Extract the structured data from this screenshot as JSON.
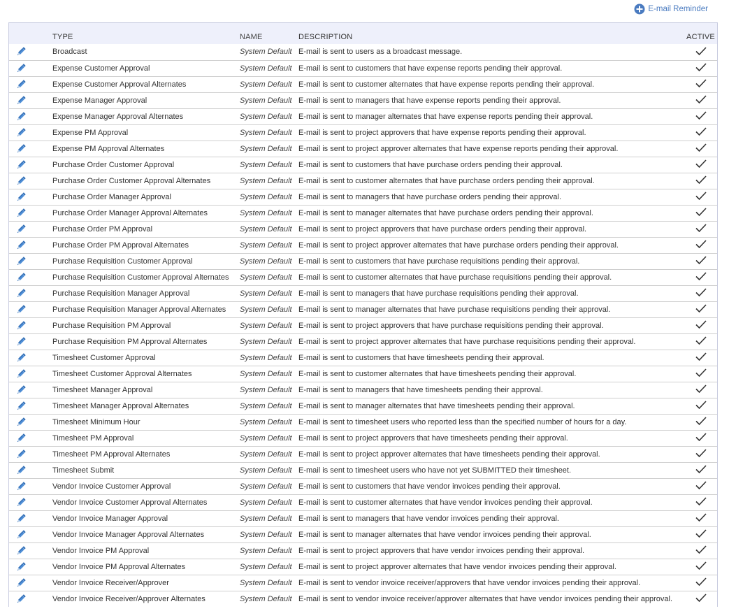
{
  "toolbar": {
    "reminder_label": "E-mail Reminder"
  },
  "columns": {
    "type": "TYPE",
    "name": "NAME",
    "description": "DESCRIPTION",
    "active": "ACTIVE"
  },
  "rows": [
    {
      "type": "Broadcast",
      "name": "System Default",
      "description": "E-mail is sent to users as a broadcast message.",
      "active": true
    },
    {
      "type": "Expense Customer Approval",
      "name": "System Default",
      "description": "E-mail is sent to customers that have expense reports pending their approval.",
      "active": true
    },
    {
      "type": "Expense Customer Approval Alternates",
      "name": "System Default",
      "description": "E-mail is sent to customer alternates that have expense reports pending their approval.",
      "active": true
    },
    {
      "type": "Expense Manager Approval",
      "name": "System Default",
      "description": "E-mail is sent to managers that have expense reports pending their approval.",
      "active": true
    },
    {
      "type": "Expense Manager Approval Alternates",
      "name": "System Default",
      "description": "E-mail is sent to manager alternates that have expense reports pending their approval.",
      "active": true
    },
    {
      "type": "Expense PM Approval",
      "name": "System Default",
      "description": "E-mail is sent to project approvers that have expense reports pending their approval.",
      "active": true
    },
    {
      "type": "Expense PM Approval Alternates",
      "name": "System Default",
      "description": "E-mail is sent to project approver alternates that have expense reports pending their approval.",
      "active": true
    },
    {
      "type": "Purchase Order Customer Approval",
      "name": "System Default",
      "description": "E-mail is sent to customers that have purchase orders pending their approval.",
      "active": true
    },
    {
      "type": "Purchase Order Customer Approval Alternates",
      "name": "System Default",
      "description": "E-mail is sent to customer alternates that have purchase orders pending their approval.",
      "active": true
    },
    {
      "type": "Purchase Order Manager Approval",
      "name": "System Default",
      "description": "E-mail is sent to managers that have purchase orders pending their approval.",
      "active": true
    },
    {
      "type": "Purchase Order Manager Approval Alternates",
      "name": "System Default",
      "description": "E-mail is sent to manager alternates that have purchase orders pending their approval.",
      "active": true
    },
    {
      "type": "Purchase Order PM Approval",
      "name": "System Default",
      "description": "E-mail is sent to project approvers that have purchase orders pending their approval.",
      "active": true
    },
    {
      "type": "Purchase Order PM Approval Alternates",
      "name": "System Default",
      "description": "E-mail is sent to project approver alternates that have purchase orders pending their approval.",
      "active": true
    },
    {
      "type": "Purchase Requisition Customer Approval",
      "name": "System Default",
      "description": "E-mail is sent to customers that have purchase requisitions pending their approval.",
      "active": true
    },
    {
      "type": "Purchase Requisition Customer Approval Alternates",
      "name": "System Default",
      "description": "E-mail is sent to customer alternates that have purchase requisitions pending their approval.",
      "active": true
    },
    {
      "type": "Purchase Requisition Manager Approval",
      "name": "System Default",
      "description": "E-mail is sent to managers that have purchase requisitions pending their approval.",
      "active": true
    },
    {
      "type": "Purchase Requisition Manager Approval Alternates",
      "name": "System Default",
      "description": "E-mail is sent to manager alternates that have purchase requisitions pending their approval.",
      "active": true
    },
    {
      "type": "Purchase Requisition PM Approval",
      "name": "System Default",
      "description": "E-mail is sent to project approvers that have purchase requisitions pending their approval.",
      "active": true
    },
    {
      "type": "Purchase Requisition PM Approval Alternates",
      "name": "System Default",
      "description": "E-mail is sent to project approver alternates that have purchase requisitions pending their approval.",
      "active": true
    },
    {
      "type": "Timesheet Customer Approval",
      "name": "System Default",
      "description": "E-mail is sent to customers that have timesheets pending their approval.",
      "active": true
    },
    {
      "type": "Timesheet Customer Approval Alternates",
      "name": "System Default",
      "description": "E-mail is sent to customer alternates that have timesheets pending their approval.",
      "active": true
    },
    {
      "type": "Timesheet Manager Approval",
      "name": "System Default",
      "description": "E-mail is sent to managers that have timesheets pending their approval.",
      "active": true
    },
    {
      "type": "Timesheet Manager Approval Alternates",
      "name": "System Default",
      "description": "E-mail is sent to manager alternates that have timesheets pending their approval.",
      "active": true
    },
    {
      "type": "Timesheet Minimum Hour",
      "name": "System Default",
      "description": "E-mail is sent to timesheet users who reported less than the specified number of hours for a day.",
      "active": true
    },
    {
      "type": "Timesheet PM Approval",
      "name": "System Default",
      "description": "E-mail is sent to project approvers that have timesheets pending their approval.",
      "active": true
    },
    {
      "type": "Timesheet PM Approval Alternates",
      "name": "System Default",
      "description": "E-mail is sent to project approver alternates that have timesheets pending their approval.",
      "active": true
    },
    {
      "type": "Timesheet Submit",
      "name": "System Default",
      "description": "E-mail is sent to timesheet users who have not yet SUBMITTED their timesheet.",
      "active": true
    },
    {
      "type": "Vendor Invoice Customer Approval",
      "name": "System Default",
      "description": "E-mail is sent to customers that have vendor invoices pending their approval.",
      "active": true
    },
    {
      "type": "Vendor Invoice Customer Approval Alternates",
      "name": "System Default",
      "description": "E-mail is sent to customer alternates that have vendor invoices pending their approval.",
      "active": true
    },
    {
      "type": "Vendor Invoice Manager Approval",
      "name": "System Default",
      "description": "E-mail is sent to managers that have vendor invoices pending their approval.",
      "active": true
    },
    {
      "type": "Vendor Invoice Manager Approval Alternates",
      "name": "System Default",
      "description": "E-mail is sent to manager alternates that have vendor invoices pending their approval.",
      "active": true
    },
    {
      "type": "Vendor Invoice PM Approval",
      "name": "System Default",
      "description": "E-mail is sent to project approvers that have vendor invoices pending their approval.",
      "active": true
    },
    {
      "type": "Vendor Invoice PM Approval Alternates",
      "name": "System Default",
      "description": "E-mail is sent to project approver alternates that have vendor invoices pending their approval.",
      "active": true
    },
    {
      "type": "Vendor Invoice Receiver/Approver",
      "name": "System Default",
      "description": "E-mail is sent to vendor invoice receiver/approvers that have vendor invoices pending their approval.",
      "active": true
    },
    {
      "type": "Vendor Invoice Receiver/Approver Alternates",
      "name": "System Default",
      "description": "E-mail is sent to vendor invoice receiver/approver alternates that have vendor invoices pending their approval.",
      "active": true
    }
  ],
  "icons": {
    "edit": "pencil-icon",
    "active": "checkmark-icon",
    "add": "plus-circle-icon"
  },
  "colors": {
    "accent": "#4a7bc0",
    "header_bg": "#eef0fb",
    "row_border": "#cfcfcf",
    "grid_border": "#c8cce0",
    "check": "#333333"
  }
}
